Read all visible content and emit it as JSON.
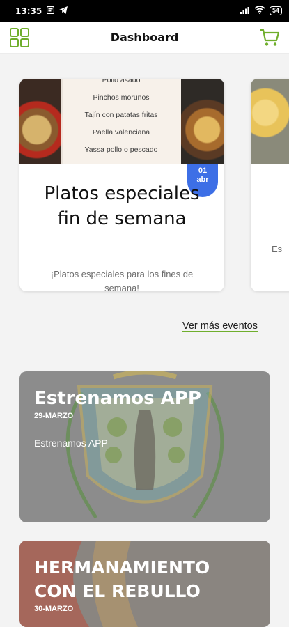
{
  "status_bar": {
    "time": "13:35",
    "battery": "54"
  },
  "header": {
    "title": "Dashboard"
  },
  "events": [
    {
      "menu_items": [
        "Pollo asado",
        "Pinchos morunos",
        "Tajín con patatas fritas",
        "Paella valenciana",
        "Yassa pollo o pescado"
      ],
      "date_day": "01",
      "date_month": "abr",
      "title": "Platos especiales fin de semana",
      "description": "¡Platos especiales para los fines de semana!"
    },
    {
      "description_fragment": "Es"
    }
  ],
  "more_events_label": "Ver más eventos",
  "news": [
    {
      "title": "Estrenamos APP",
      "date": "29-MARZO",
      "body": "Estrenamos APP"
    },
    {
      "title": "HERMANAMIENTO CON EL REBULLO",
      "date": "30-MARZO"
    }
  ],
  "colors": {
    "accent_green": "#6fae2c",
    "badge_blue": "#3d6fe6"
  }
}
